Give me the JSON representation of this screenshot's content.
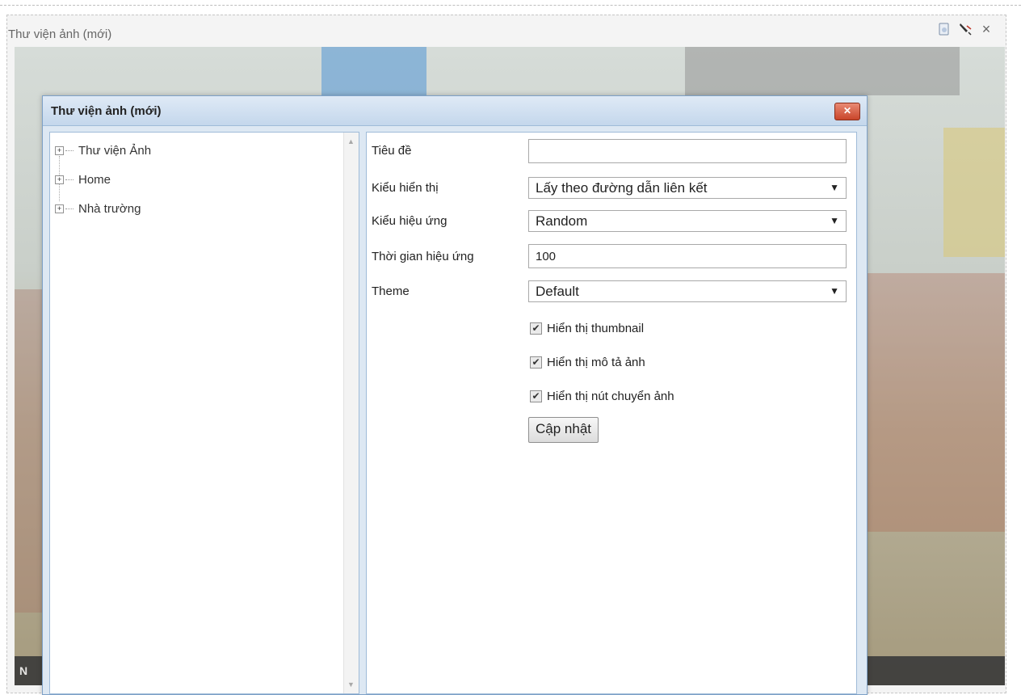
{
  "widget": {
    "title": "Thư viện ảnh (mới)",
    "tools": [
      "page-icon",
      "edit-icon",
      "close-icon"
    ],
    "close_glyph": "×",
    "caption_text": "N"
  },
  "dialog": {
    "title": "Thư viện ảnh (mới)",
    "close_glyph": "✕"
  },
  "tree": {
    "items": [
      {
        "label": "Thư viện Ảnh",
        "expander": "+"
      },
      {
        "label": "Home",
        "expander": "+"
      },
      {
        "label": "Nhà trường",
        "expander": "+"
      }
    ],
    "scroll_up": "▲",
    "scroll_down": "▼"
  },
  "form": {
    "title_label": "Tiêu đề",
    "title_value": "",
    "display_label": "Kiểu hiển thị",
    "display_value": "Lấy theo đường dẫn liên kết",
    "effect_label": "Kiểu hiệu ứng",
    "effect_value": "Random",
    "duration_label": "Thời gian hiệu ứng",
    "duration_value": "100",
    "theme_label": "Theme",
    "theme_value": "Default",
    "select_arrow": "▼",
    "checkboxes": [
      {
        "label": "Hiển thị thumbnail",
        "checked": true
      },
      {
        "label": "Hiển thị mô tả ảnh",
        "checked": true
      },
      {
        "label": "Hiển thị nút chuyển ảnh",
        "checked": true
      }
    ],
    "check_glyph": "✔",
    "update_button": "Cập nhật"
  },
  "colors": {
    "dialog_header": "#c4d7ec",
    "dialog_border": "#7ea1c7",
    "close_button": "#c9452a"
  }
}
